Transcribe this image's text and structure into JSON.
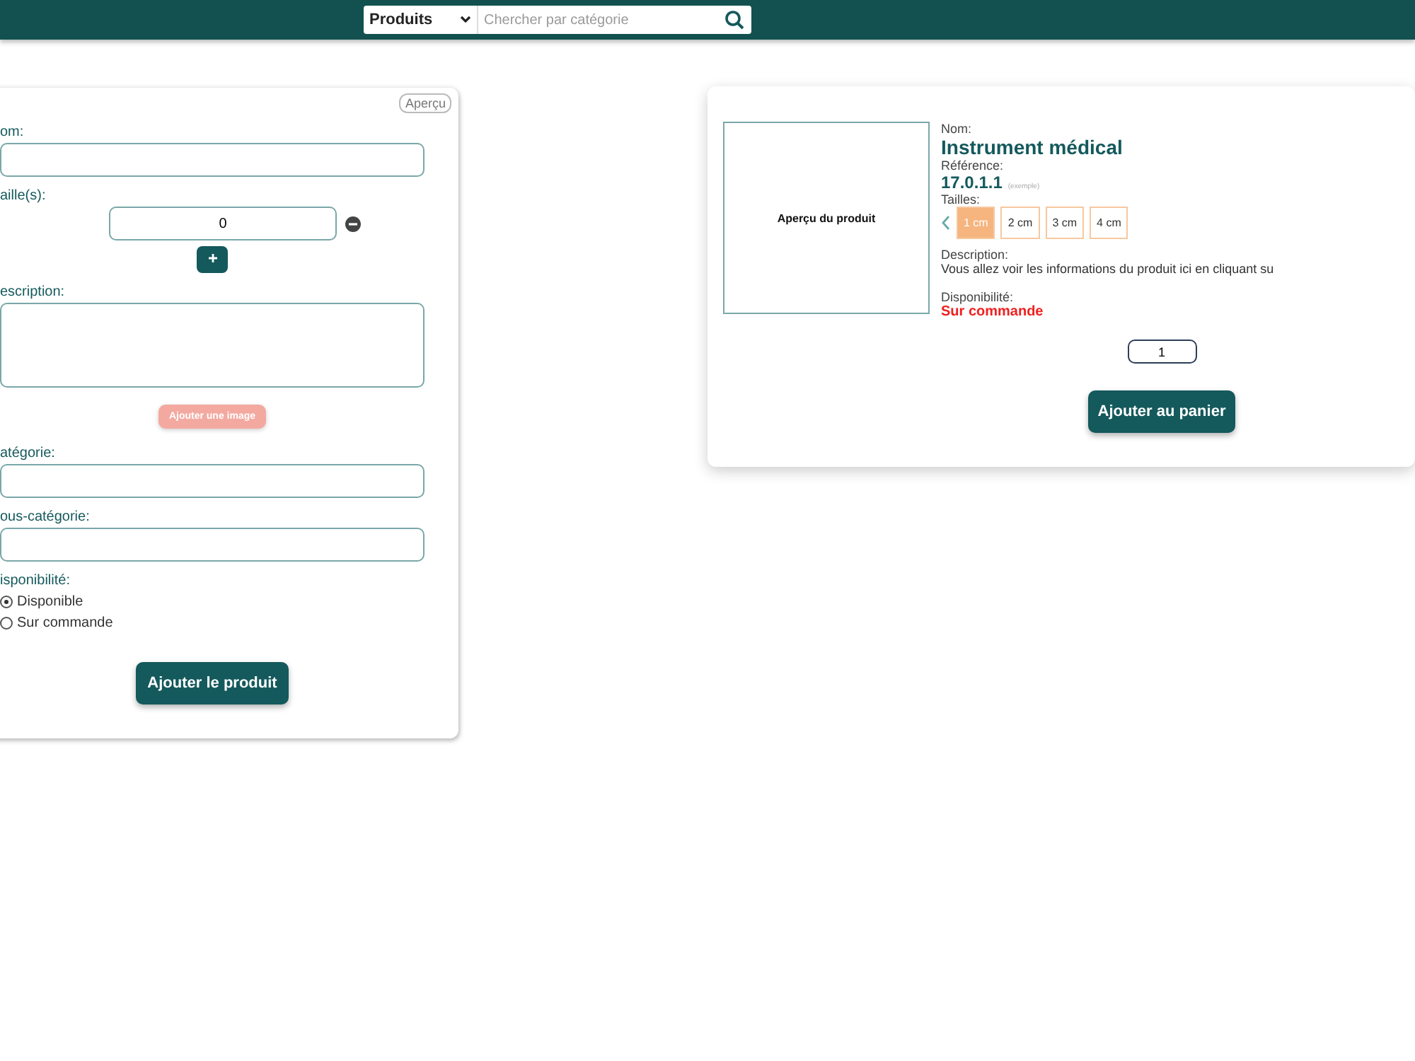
{
  "header": {
    "category_select": "Produits",
    "search_placeholder": "Chercher par catégorie"
  },
  "form": {
    "preview_button": "Aperçu",
    "fields": [
      {
        "kind": "text",
        "label": "om:"
      },
      {
        "kind": "sizes",
        "label": "aille(s):",
        "value": "0"
      },
      {
        "kind": "textarea",
        "label": "escription:"
      },
      {
        "kind": "image",
        "label": "Ajouter une image",
        "disabled": true
      },
      {
        "kind": "text",
        "label": "atégorie:"
      },
      {
        "kind": "text",
        "label": "ous-catégorie:"
      },
      {
        "kind": "radio",
        "label": "isponibilité:",
        "options": [
          {
            "label": "Disponible",
            "selected": true
          },
          {
            "label": "Sur commande",
            "selected": false
          }
        ]
      }
    ],
    "submit": "Ajouter le produit"
  },
  "preview": {
    "image_label": "Aperçu du produit",
    "name_label": "Nom:",
    "name": "Instrument médical",
    "reference_label": "Référence:",
    "reference": "17.0.1.1",
    "reference_note": "(exemple)",
    "sizes_label": "Tailles:",
    "sizes": [
      {
        "label": "1 cm",
        "selected": true
      },
      {
        "label": "2 cm",
        "selected": false
      },
      {
        "label": "3 cm",
        "selected": false
      },
      {
        "label": "4 cm",
        "selected": false
      }
    ],
    "description_label": "Description:",
    "description": "Vous allez voir les informations du produit ici en cliquant su",
    "availability_label": "Disponibilité:",
    "availability": "Sur commande",
    "quantity": "1",
    "cart_button": "Ajouter au panier"
  }
}
